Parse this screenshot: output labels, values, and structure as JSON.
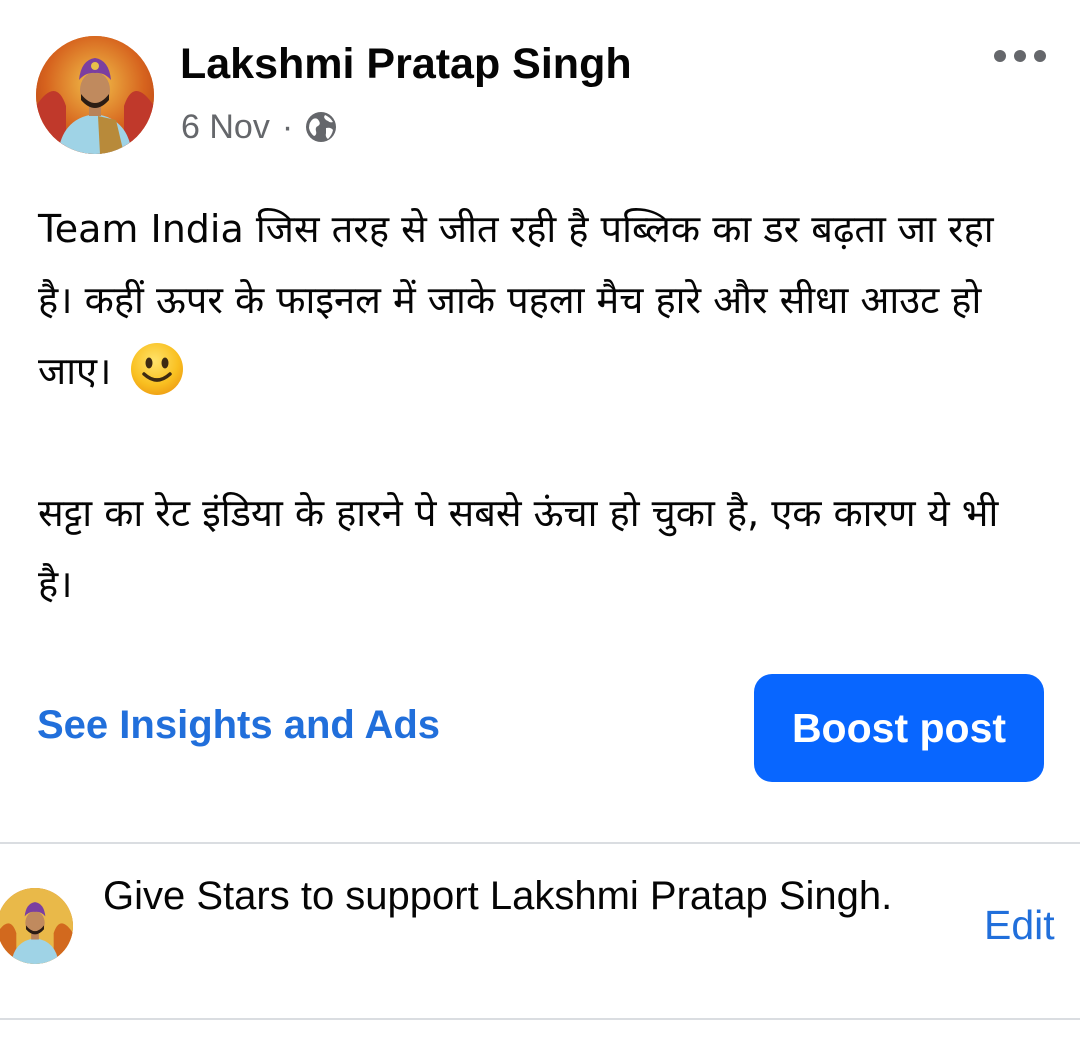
{
  "post": {
    "author_name": "Lakshmi Pratap Singh",
    "timestamp": "6 Nov",
    "separator": "·",
    "audience_icon": "globe-icon",
    "more_icon": "more-dots-icon",
    "paragraph_1": "Team India जिस तरह से जीत रही है पब्लिक का डर बढ़ता जा रहा है। कहीं ऊपर के फाइनल में जाके पहला मैच हारे और सीधा आउट हो जाए।",
    "paragraph_1_emoji": "slightly-smiling-face-emoji",
    "paragraph_2": "सट्टा का रेट इंडिया के हारने पे सबसे ऊंचा हो चुका है, एक कारण ये भी है।"
  },
  "actions": {
    "insights_label": "See Insights and Ads",
    "boost_label": "Boost post"
  },
  "stars": {
    "text": "Give Stars to support Lakshmi Pratap Singh.",
    "edit_label": "Edit"
  },
  "colors": {
    "link_blue": "#216fdb",
    "button_blue": "#0866ff",
    "secondary_text": "#65676b",
    "divider": "#dadde1"
  }
}
